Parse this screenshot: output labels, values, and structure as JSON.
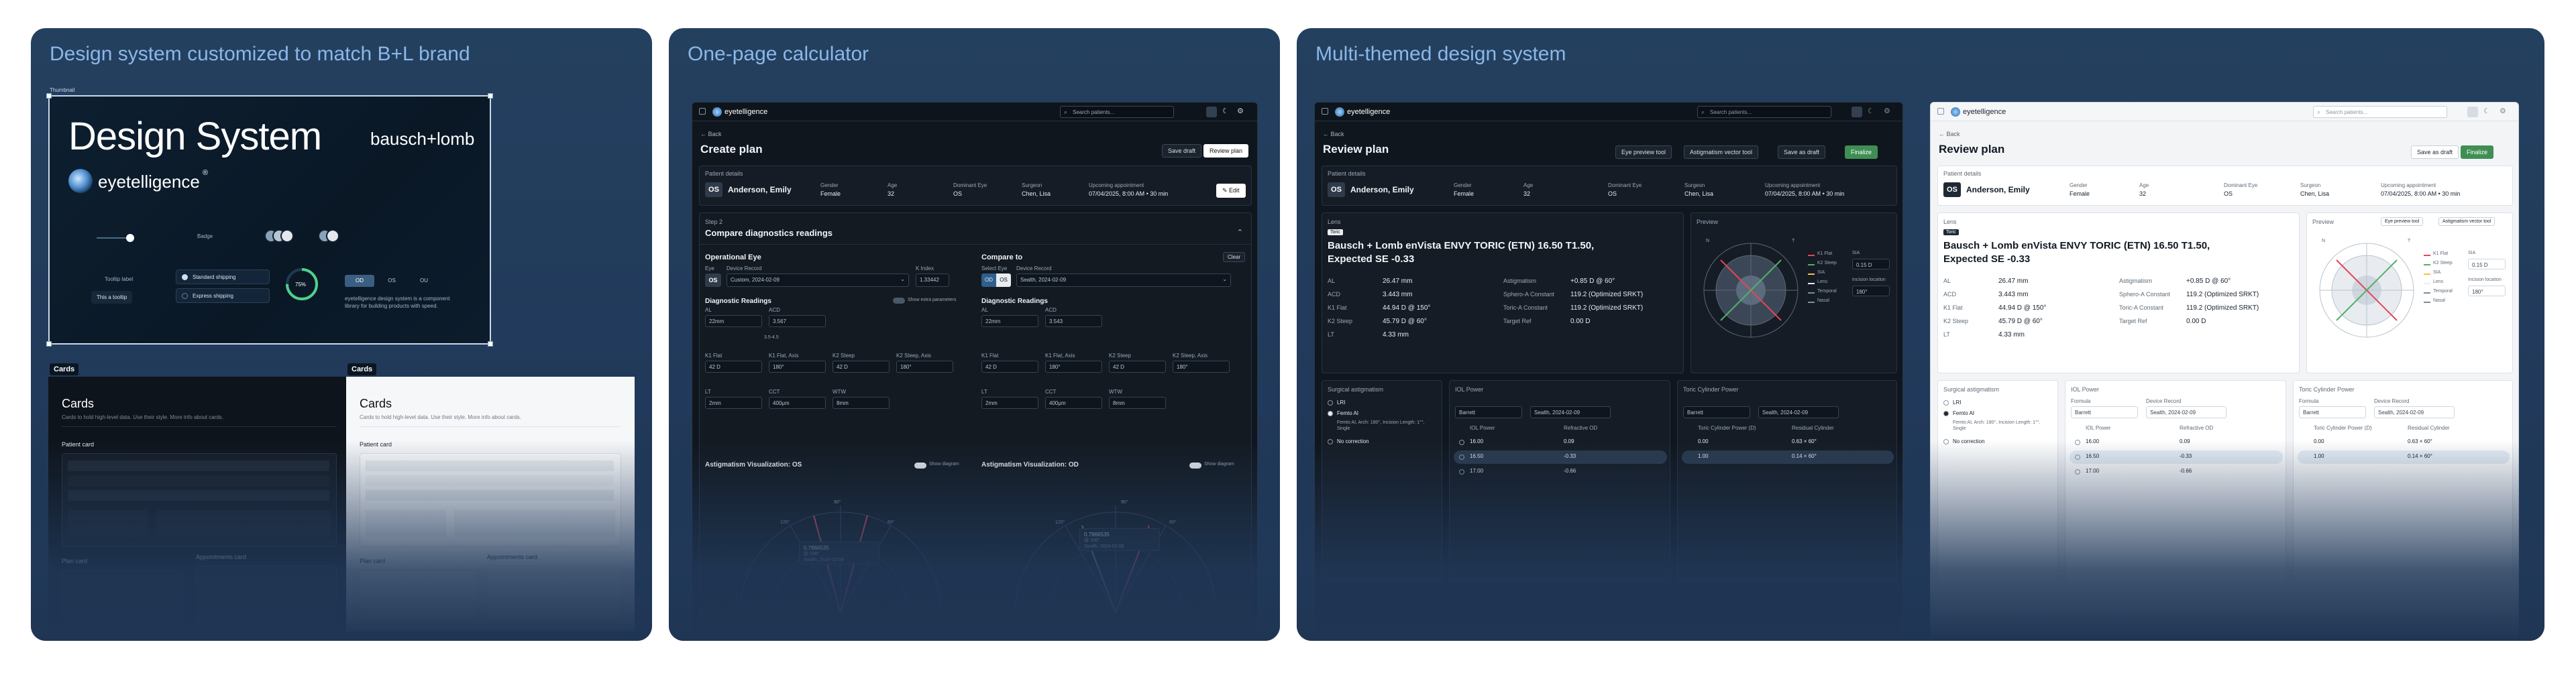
{
  "panels": {
    "design": {
      "title": "Design system customized to match B+L brand"
    },
    "calc": {
      "title": "One-page calculator"
    },
    "themes": {
      "title": "Multi-themed design system"
    }
  },
  "design_thumb": {
    "label": "Thumbnail",
    "heading": "Design System",
    "brand": "bausch+lomb",
    "product": "eyetelligence",
    "product_mark": "®",
    "tooltip_label": "Tooltip label",
    "tooltip_text": "This a tooltip",
    "badge_label": "Badge",
    "option1": "Standard shipping",
    "option2": "Express shipping",
    "progress": "75%",
    "seg1": "OD",
    "seg2": "OS",
    "seg3": "OU",
    "caption": "eyetelligence design system is a component library for building products with speed."
  },
  "cards_dark": {
    "tag": "Cards",
    "title": "Cards",
    "sub": "Cards to hold high-level data. Use their style. More info about cards.",
    "patient": "Patient card",
    "plan": "Plan card",
    "appointments": "Appointments card"
  },
  "cards_light": {
    "tag": "Cards",
    "title": "Cards",
    "sub": "Cards to hold high-level data. Use their style. More info about cards.",
    "patient": "Patient card",
    "plan": "Plan card",
    "appointments": "Appointments card"
  },
  "app": {
    "logo": "eyetelligence",
    "search": "Search patients...",
    "back": "Back"
  },
  "calc": {
    "page_title": "Create plan",
    "save_draft": "Save draft",
    "review_plan": "Review plan",
    "patient_details": "Patient details",
    "eye_code": "OS",
    "patient_name": "Anderson, Emily",
    "fields": [
      {
        "label": "Gender",
        "value": "Female"
      },
      {
        "label": "Age",
        "value": "32"
      },
      {
        "label": "Dominant Eye",
        "value": "OS"
      },
      {
        "label": "Surgeon",
        "value": "Chen, Lisa"
      },
      {
        "label": "Upcoming appointment",
        "value": "07/04/2025, 8:00 AM • 30 min"
      }
    ],
    "edit": "Edit",
    "step": "Step 2",
    "step_title": "Compare diagnostics readings",
    "operational_eye": "Operational Eye",
    "compare_to": "Compare to",
    "clear": "Clear",
    "eye": "Eye",
    "device_record": "Device Record",
    "k_index": "K Index",
    "select_eye": "Select Eye",
    "left_eye": "OS",
    "left_device": "Custom, 2024-02-09",
    "k_index_val": "1.33442",
    "right_seg1": "OD",
    "right_seg2": "OS",
    "right_device": "Sealth, 2024-02-09",
    "diag_readings": "Diagnostic Readings",
    "show_extra": "Show extra parameters",
    "left_rows": [
      [
        {
          "l": "AL",
          "v": "22mm"
        },
        {
          "l": "ACD",
          "v": "3.567"
        }
      ],
      [
        {
          "l": "K1 Flat",
          "v": "42 D"
        },
        {
          "l": "K1 Flat, Axis",
          "v": "180°"
        },
        {
          "l": "K2 Steep",
          "v": "42 D"
        },
        {
          "l": "K2 Steep, Axis",
          "v": "180°"
        }
      ],
      [
        {
          "l": "LT",
          "v": "2mm"
        },
        {
          "l": "CCT",
          "v": "400μm"
        },
        {
          "l": "WTW",
          "v": "8mm"
        }
      ]
    ],
    "right_rows": [
      [
        {
          "l": "AL",
          "v": "22mm"
        },
        {
          "l": "ACD",
          "v": "3.543"
        }
      ],
      [
        {
          "l": "K1 Flat",
          "v": "42 D"
        },
        {
          "l": "K1 Flat, Axis",
          "v": "180°"
        },
        {
          "l": "K2 Steep",
          "v": "42 D"
        },
        {
          "l": "K2 Steep, Axis",
          "v": "180°"
        }
      ],
      [
        {
          "l": "LT",
          "v": "2mm"
        },
        {
          "l": "CCT",
          "v": "400μm"
        },
        {
          "l": "WTW",
          "v": "8mm"
        }
      ]
    ],
    "range_note": "3.5-4.5",
    "astig_left": "Astigmatism Visualization: OS",
    "astig_right": "Astigmatism Visualization: OD",
    "show_diagram": "Show diagram",
    "tip_left": "0.7866535",
    "tip_right": "0.7866535",
    "tip_sub": "@ 106°",
    "tip_dev": "Sealth, 2024-02-09",
    "angles": [
      "90°",
      "60°",
      "120°",
      "150°",
      "30°"
    ]
  },
  "review": {
    "page_title": "Review plan",
    "eye_preview": "Eye preview tool",
    "astig_vector": "Astigmatism vector tool",
    "save_draft": "Save as draft",
    "finalize": "Finalize",
    "patient_details": "Patient details",
    "eye_code": "OS",
    "patient_name": "Anderson, Emily",
    "fields": [
      {
        "label": "Gender",
        "value": "Female"
      },
      {
        "label": "Age",
        "value": "32"
      },
      {
        "label": "Dominant Eye",
        "value": "OS"
      },
      {
        "label": "Surgeon",
        "value": "Chen, Lisa"
      },
      {
        "label": "Upcoming appointment",
        "value": "07/04/2025, 8:00 AM • 30 min"
      }
    ],
    "lens": "Lens",
    "toric": "Toric",
    "lens_name": "Bausch + Lomb enVista ENVY TORIC (ETN) 16.50  T1.50,",
    "lens_name2": "Expected SE -0.33",
    "left_stats": [
      {
        "l": "AL",
        "v": "26.47 mm"
      },
      {
        "l": "ACD",
        "v": "3.443 mm"
      },
      {
        "l": "K1 Flat",
        "v": "44.94 D @ 150°"
      },
      {
        "l": "K2 Steep",
        "v": "45.79 D @ 60°"
      },
      {
        "l": "LT",
        "v": "4.33 mm"
      }
    ],
    "right_stats": [
      {
        "l": "Astigmatism",
        "v": "+0.85 D @ 60°"
      },
      {
        "l": "Sphero-A Constant",
        "v": "119.2 (Optimized SRKT)"
      },
      {
        "l": "Toric-A Constant",
        "v": "119.2 (Optimized SRKT)"
      },
      {
        "l": "Target Ref",
        "v": "0.00 D"
      }
    ],
    "preview": "Preview",
    "legend": [
      "K1 Flat",
      "K2 Steep",
      "SIA",
      "Lens",
      "Temporal",
      "Nasal"
    ],
    "sia": "SIA",
    "sia_val": "0.15 D",
    "incision": "Incision location",
    "incision_val": "180°",
    "surgical": "Surgical astigmatism",
    "iol_power": "IOL Power",
    "toric_cyl": "Toric Cylinder Power",
    "formula": "Formula",
    "device_record": "Device Record",
    "barrett": "Barrett",
    "sealth": "Sealth, 2024-02-09",
    "iol_col": "IOL Power",
    "ref_col": "Refractive OD",
    "cyl_col": "Toric Cylinder Power (D)",
    "res_col": "Residual Cylinder",
    "opt_lri": "LRI",
    "opt_femto": "Femto AI",
    "femto_sub": "Femto AI, Arch: 180°, Incision Length: 1°°, Single",
    "opt_none": "No correction",
    "iol_rows": [
      {
        "p": "16.00",
        "r": "0.09"
      },
      {
        "p": "16.50",
        "r": "-0.33"
      },
      {
        "p": "17.00",
        "r": "-0.66"
      }
    ],
    "cyl_rows": [
      {
        "p": "0.00",
        "r": "0.63 × 60°"
      },
      {
        "p": "1.00",
        "r": "0.14 × 60°"
      }
    ],
    "angles": [
      "90°",
      "60°",
      "120°",
      "N",
      "T"
    ]
  }
}
